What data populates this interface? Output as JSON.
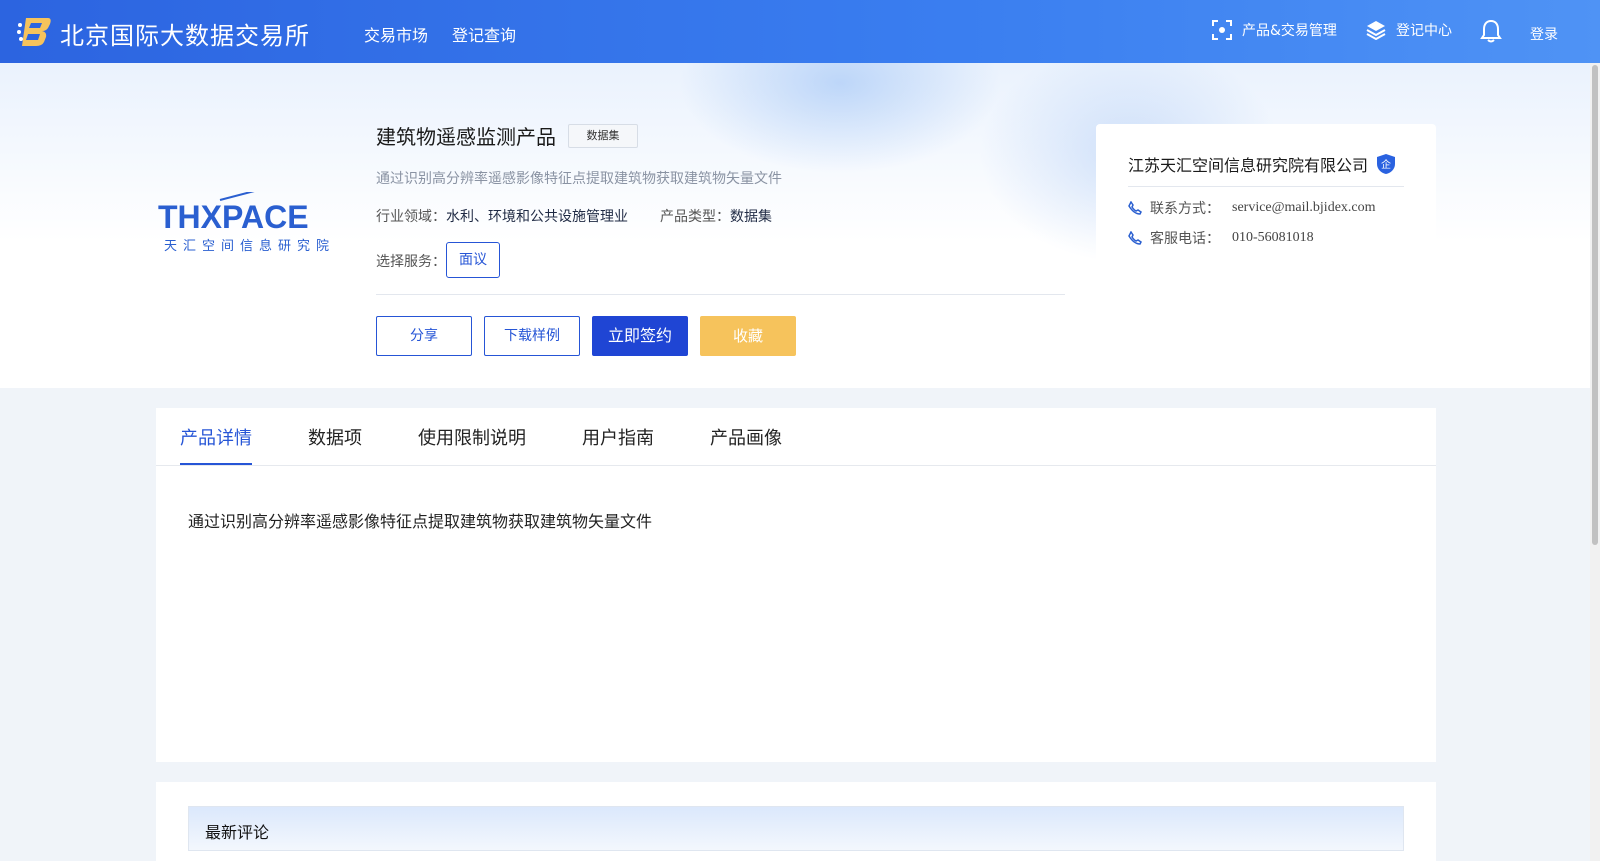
{
  "header": {
    "brand": "北京国际大数据交易所",
    "nav": [
      "交易市场",
      "登记查询"
    ],
    "product_trade_mgmt": "产品&交易管理",
    "register_center": "登记中心",
    "login": "登录"
  },
  "product": {
    "logo_text": "THXPACE",
    "logo_subtext": "天汇空间信息研究院",
    "title": "建筑物遥感监测产品",
    "tag": "数据集",
    "description": "通过识别高分辨率遥感影像特征点提取建筑物获取建筑物矢量文件",
    "industry_label": "行业领域：",
    "industry_value": "水利、环境和公共设施管理业",
    "type_label": "产品类型：",
    "type_value": "数据集",
    "service_label": "选择服务：",
    "service_option": "面议",
    "buttons": {
      "share": "分享",
      "download_sample": "下载样例",
      "sign_now": "立即签约",
      "favorite": "收藏"
    }
  },
  "company": {
    "name": "江苏天汇空间信息研究院有限公司",
    "badge": "企",
    "contact_label": "联系方式：",
    "contact_value": "service@mail.bjidex.com",
    "phone_label": "客服电话：",
    "phone_value": "010-56081018"
  },
  "tabs": [
    "产品详情",
    "数据项",
    "使用限制说明",
    "用户指南",
    "产品画像"
  ],
  "detail_text": "通过识别高分辨率遥感影像特征点提取建筑物获取建筑物矢量文件",
  "comments": {
    "title": "最新评论"
  },
  "colors": {
    "primary": "#2655d6",
    "favorite": "#f6c35c",
    "header": "#3a7ef0"
  }
}
